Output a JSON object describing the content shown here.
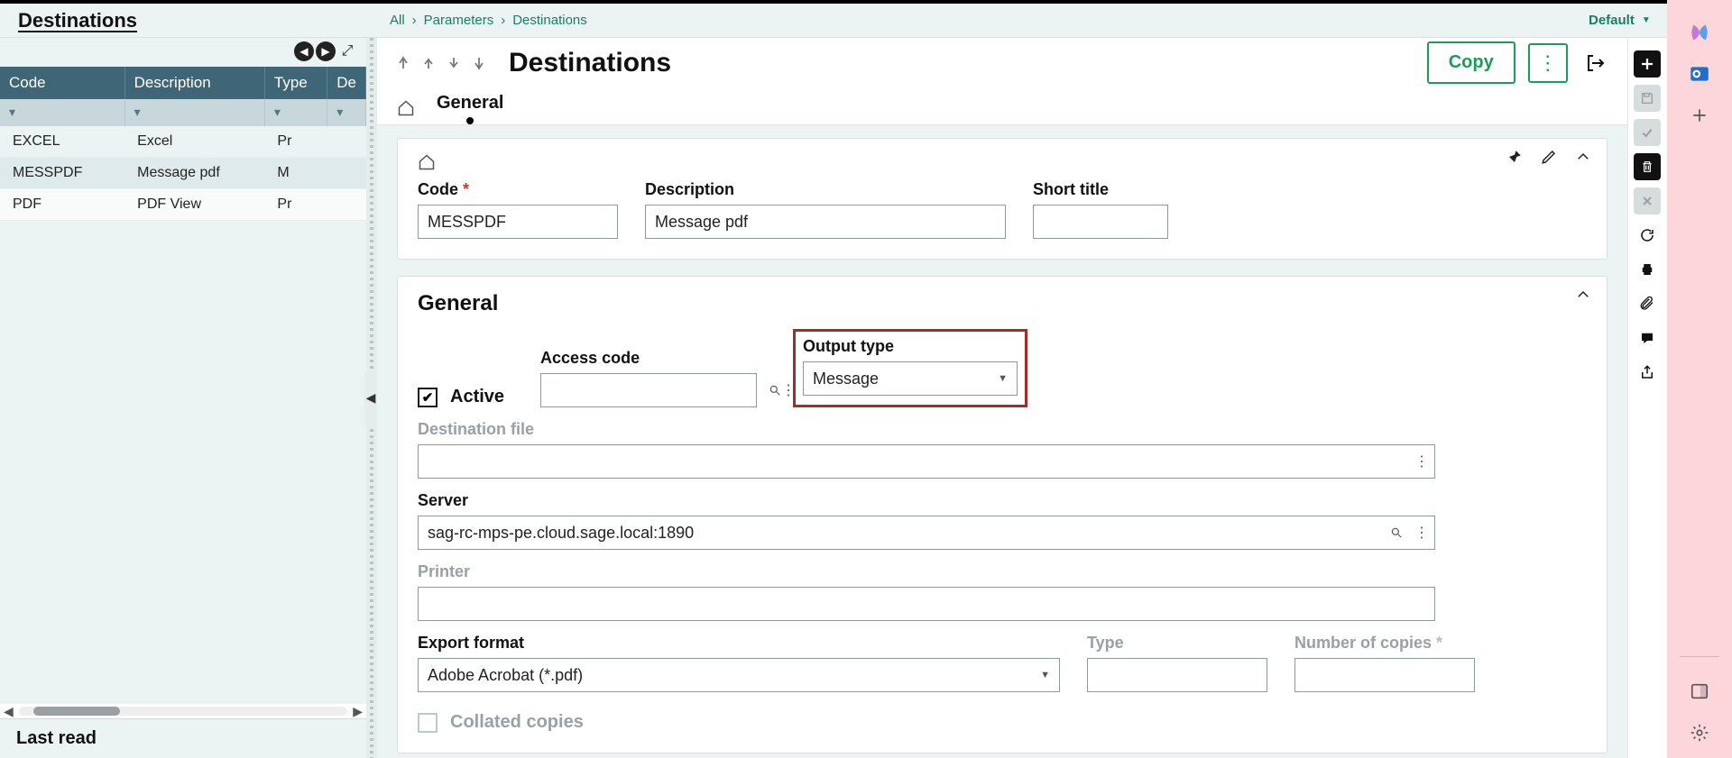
{
  "os": {
    "icons": [
      "copilot",
      "outlook",
      "add"
    ],
    "bottom": [
      "panel",
      "settings"
    ]
  },
  "breadcrumb": {
    "all": "All",
    "params": "Parameters",
    "dest": "Destinations",
    "endpoint": "Default"
  },
  "left": {
    "title": "Destinations",
    "headers": {
      "code": "Code",
      "desc": "Description",
      "type": "Type",
      "de": "De"
    },
    "rows": [
      {
        "code": "EXCEL",
        "desc": "Excel",
        "type": "Pr"
      },
      {
        "code": "MESSPDF",
        "desc": "Message pdf",
        "type": "M"
      },
      {
        "code": "PDF",
        "desc": "PDF View",
        "type": "Pr"
      }
    ],
    "lastread": "Last read"
  },
  "header": {
    "title": "Destinations",
    "copy": "Copy",
    "tabs": {
      "general": "General"
    }
  },
  "card1": {
    "code_label": "Code",
    "code_value": "MESSPDF",
    "desc_label": "Description",
    "desc_value": "Message pdf",
    "short_label": "Short title",
    "short_value": ""
  },
  "general": {
    "title": "General",
    "active": "Active",
    "access_label": "Access code",
    "access_value": "",
    "output_label": "Output type",
    "output_value": "Message",
    "destfile_label": "Destination file",
    "destfile_value": "",
    "server_label": "Server",
    "server_value": "sag-rc-mps-pe.cloud.sage.local:1890",
    "printer_label": "Printer",
    "printer_value": "",
    "export_label": "Export format",
    "export_value": "Adobe Acrobat (*.pdf)",
    "type_label": "Type",
    "type_value": "",
    "copies_label": "Number of copies",
    "copies_value": "",
    "collated": "Collated copies"
  }
}
